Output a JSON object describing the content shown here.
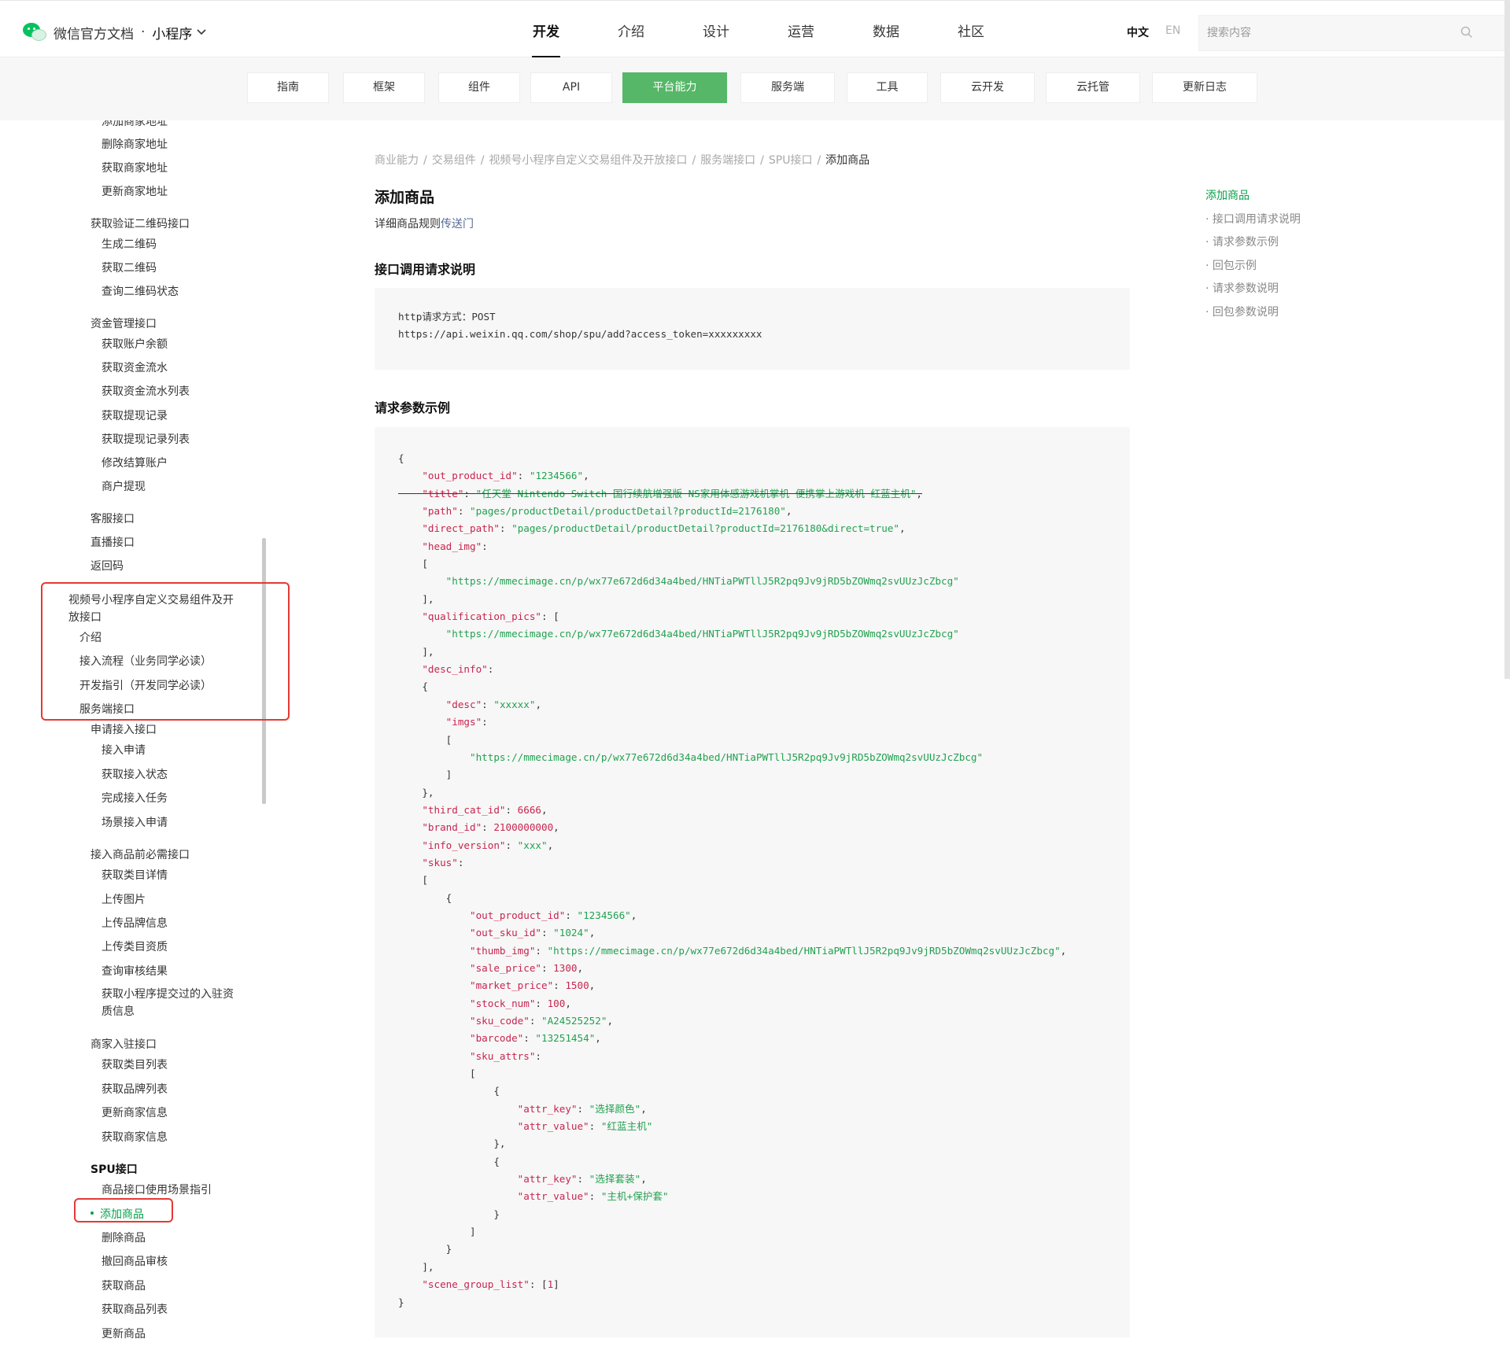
{
  "header": {
    "brand": "微信官方文档",
    "brand_dot": "·",
    "product": "小程序",
    "nav": [
      "开发",
      "介绍",
      "设计",
      "运营",
      "数据",
      "社区"
    ],
    "lang_zh": "中文",
    "lang_en": "EN",
    "search_placeholder": "搜索内容"
  },
  "subnav": [
    "指南",
    "框架",
    "组件",
    "API",
    "平台能力",
    "服务端",
    "工具",
    "云开发",
    "云托管",
    "更新日志"
  ],
  "sidebar": [
    "添加商家地址",
    "删除商家地址",
    "获取商家地址",
    "更新商家地址",
    "获取验证二维码接口",
    "生成二维码",
    "获取二维码",
    "查询二维码状态",
    "资金管理接口",
    "获取账户余额",
    "获取资金流水",
    "获取资金流水列表",
    "获取提现记录",
    "获取提现记录列表",
    "修改结算账户",
    "商户提现",
    "客服接口",
    "直播接口",
    "返回码",
    "视频号小程序自定义交易组件及开放接口",
    "介绍",
    "接入流程（业务同学必读）",
    "开发指引（开发同学必读）",
    "服务端接口",
    "申请接入接口",
    "接入申请",
    "获取接入状态",
    "完成接入任务",
    "场景接入申请",
    "接入商品前必需接口",
    "获取类目详情",
    "上传图片",
    "上传品牌信息",
    "上传类目资质",
    "查询审核结果",
    "获取小程序提交过的入驻资质信息",
    "商家入驻接口",
    "获取类目列表",
    "获取品牌列表",
    "更新商家信息",
    "获取商家信息",
    "SPU接口",
    "商品接口使用场景指引",
    "添加商品",
    "删除商品",
    "撤回商品审核",
    "获取商品",
    "获取商品列表",
    "更新商品"
  ],
  "breadcrumb": [
    "商业能力",
    "交易组件",
    "视频号小程序自定义交易组件及开放接口",
    "服务端接口",
    "SPU接口",
    "添加商品"
  ],
  "breadcrumb_sep": "/",
  "page": {
    "title": "添加商品",
    "intro": "详细商品规则",
    "intro_link": "传送门",
    "section1": "接口调用请求说明",
    "request_method_label": "http请求方式：",
    "request_method": "POST",
    "request_url": "https://api.weixin.qq.com/shop/spu/add?access_token=xxxxxxxxx",
    "section2": "请求参数示例"
  },
  "code": {
    "out_product_id": "1234566",
    "title": "任天堂 Nintendo Switch 国行续航增强版 NS家用体感游戏机掌机 便携掌上游戏机 红蓝主机",
    "path": "pages/productDetail/productDetail?productId=2176180",
    "direct_path": "pages/productDetail/productDetail?productId=2176180&direct=true",
    "img_url": "https://mmecimage.cn/p/wx77e672d6d34a4bed/HNTiaPWTllJ5R2pq9Jv9jRD5bZOWmq2svUUzJcZbcg",
    "desc": "xxxxx",
    "third_cat_id": "6666",
    "brand_id": "2100000000",
    "info_version": "xxx",
    "sku_out_product_id": "1234566",
    "out_sku_id": "1024",
    "sale_price": "1300",
    "market_price": "1500",
    "stock_num": "100",
    "sku_code": "A24525252",
    "barcode": "13251454",
    "attr_key_1": "选择颜色",
    "attr_value_1": "红蓝主机",
    "attr_key_2": "选择套装",
    "attr_value_2": "主机+保护套",
    "scene_group_value": "1"
  },
  "toc": [
    "添加商品",
    "· 接口调用请求说明",
    "· 请求参数示例",
    "· 回包示例",
    "· 请求参数说明",
    "· 回包参数说明"
  ],
  "colors": {
    "accent": "#55b767",
    "link": "#576b95",
    "highlight_box": "#e53935"
  }
}
